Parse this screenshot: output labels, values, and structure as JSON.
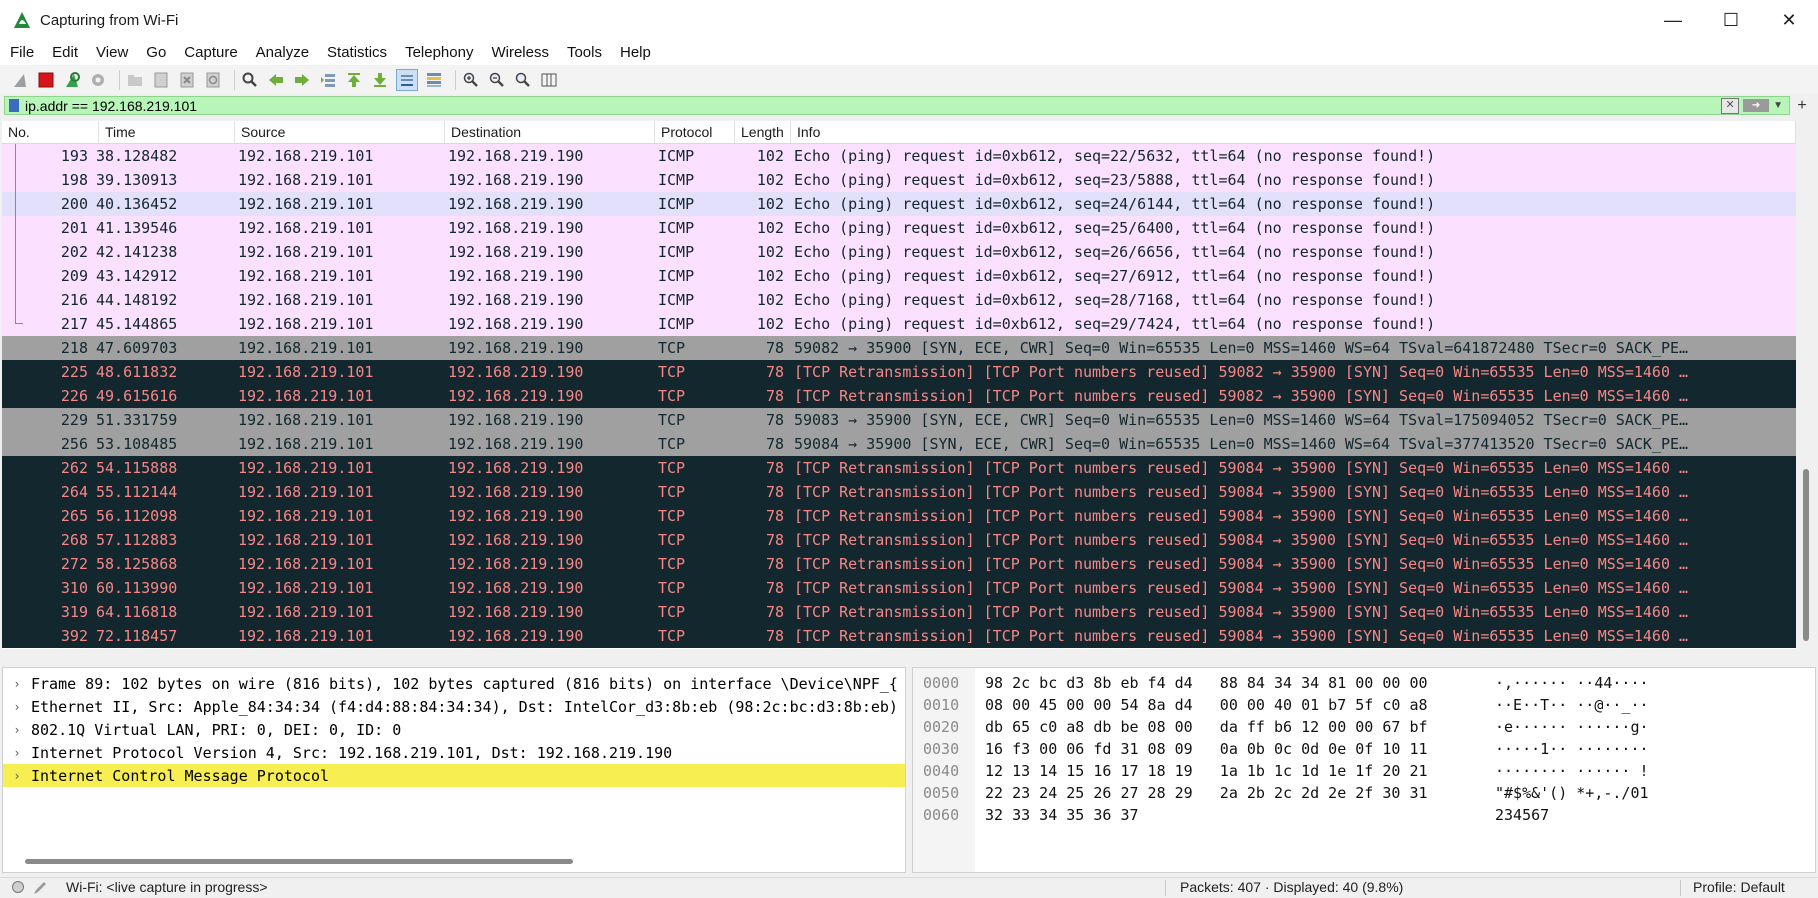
{
  "window": {
    "title": "Capturing from Wi-Fi",
    "controls": {
      "minimize": "—",
      "maximize": "☐",
      "close": "✕"
    }
  },
  "menu": [
    "File",
    "Edit",
    "View",
    "Go",
    "Capture",
    "Analyze",
    "Statistics",
    "Telephony",
    "Wireless",
    "Tools",
    "Help"
  ],
  "filter": {
    "value": "ip.addr == 192.168.219.101",
    "plus": "+"
  },
  "columns": [
    "No.",
    "Time",
    "Source",
    "Destination",
    "Protocol",
    "Length",
    "Info"
  ],
  "packets": [
    {
      "no": "193",
      "time": "38.128482",
      "src": "192.168.219.101",
      "dst": "192.168.219.190",
      "proto": "ICMP",
      "len": "102",
      "info": "Echo (ping) request  id=0xb612, seq=22/5632, ttl=64 (no response found!)",
      "style": "icmp"
    },
    {
      "no": "198",
      "time": "39.130913",
      "src": "192.168.219.101",
      "dst": "192.168.219.190",
      "proto": "ICMP",
      "len": "102",
      "info": "Echo (ping) request  id=0xb612, seq=23/5888, ttl=64 (no response found!)",
      "style": "icmp"
    },
    {
      "no": "200",
      "time": "40.136452",
      "src": "192.168.219.101",
      "dst": "192.168.219.190",
      "proto": "ICMP",
      "len": "102",
      "info": "Echo (ping) request  id=0xb612, seq=24/6144, ttl=64 (no response found!)",
      "style": "icmp sel"
    },
    {
      "no": "201",
      "time": "41.139546",
      "src": "192.168.219.101",
      "dst": "192.168.219.190",
      "proto": "ICMP",
      "len": "102",
      "info": "Echo (ping) request  id=0xb612, seq=25/6400, ttl=64 (no response found!)",
      "style": "icmp"
    },
    {
      "no": "202",
      "time": "42.141238",
      "src": "192.168.219.101",
      "dst": "192.168.219.190",
      "proto": "ICMP",
      "len": "102",
      "info": "Echo (ping) request  id=0xb612, seq=26/6656, ttl=64 (no response found!)",
      "style": "icmp"
    },
    {
      "no": "209",
      "time": "43.142912",
      "src": "192.168.219.101",
      "dst": "192.168.219.190",
      "proto": "ICMP",
      "len": "102",
      "info": "Echo (ping) request  id=0xb612, seq=27/6912, ttl=64 (no response found!)",
      "style": "icmp"
    },
    {
      "no": "216",
      "time": "44.148192",
      "src": "192.168.219.101",
      "dst": "192.168.219.190",
      "proto": "ICMP",
      "len": "102",
      "info": "Echo (ping) request  id=0xb612, seq=28/7168, ttl=64 (no response found!)",
      "style": "icmp"
    },
    {
      "no": "217",
      "time": "45.144865",
      "src": "192.168.219.101",
      "dst": "192.168.219.190",
      "proto": "ICMP",
      "len": "102",
      "info": "Echo (ping) request  id=0xb612, seq=29/7424, ttl=64 (no response found!)",
      "style": "icmp"
    },
    {
      "no": "218",
      "time": "47.609703",
      "src": "192.168.219.101",
      "dst": "192.168.219.190",
      "proto": "TCP",
      "len": "78",
      "info": "59082 → 35900 [SYN, ECE, CWR] Seq=0 Win=65535 Len=0 MSS=1460 WS=64 TSval=641872480 TSecr=0 SACK_PE…",
      "style": "tcpsyn"
    },
    {
      "no": "225",
      "time": "48.611832",
      "src": "192.168.219.101",
      "dst": "192.168.219.190",
      "proto": "TCP",
      "len": "78",
      "info": "[TCP Retransmission] [TCP Port numbers reused] 59082 → 35900 [SYN] Seq=0 Win=65535 Len=0 MSS=1460 …",
      "style": "retrans"
    },
    {
      "no": "226",
      "time": "49.615616",
      "src": "192.168.219.101",
      "dst": "192.168.219.190",
      "proto": "TCP",
      "len": "78",
      "info": "[TCP Retransmission] [TCP Port numbers reused] 59082 → 35900 [SYN] Seq=0 Win=65535 Len=0 MSS=1460 …",
      "style": "retrans"
    },
    {
      "no": "229",
      "time": "51.331759",
      "src": "192.168.219.101",
      "dst": "192.168.219.190",
      "proto": "TCP",
      "len": "78",
      "info": "59083 → 35900 [SYN, ECE, CWR] Seq=0 Win=65535 Len=0 MSS=1460 WS=64 TSval=175094052 TSecr=0 SACK_PE…",
      "style": "tcpsyn"
    },
    {
      "no": "256",
      "time": "53.108485",
      "src": "192.168.219.101",
      "dst": "192.168.219.190",
      "proto": "TCP",
      "len": "78",
      "info": "59084 → 35900 [SYN, ECE, CWR] Seq=0 Win=65535 Len=0 MSS=1460 WS=64 TSval=377413520 TSecr=0 SACK_PE…",
      "style": "tcpsyn"
    },
    {
      "no": "262",
      "time": "54.115888",
      "src": "192.168.219.101",
      "dst": "192.168.219.190",
      "proto": "TCP",
      "len": "78",
      "info": "[TCP Retransmission] [TCP Port numbers reused] 59084 → 35900 [SYN] Seq=0 Win=65535 Len=0 MSS=1460 …",
      "style": "retrans"
    },
    {
      "no": "264",
      "time": "55.112144",
      "src": "192.168.219.101",
      "dst": "192.168.219.190",
      "proto": "TCP",
      "len": "78",
      "info": "[TCP Retransmission] [TCP Port numbers reused] 59084 → 35900 [SYN] Seq=0 Win=65535 Len=0 MSS=1460 …",
      "style": "retrans"
    },
    {
      "no": "265",
      "time": "56.112098",
      "src": "192.168.219.101",
      "dst": "192.168.219.190",
      "proto": "TCP",
      "len": "78",
      "info": "[TCP Retransmission] [TCP Port numbers reused] 59084 → 35900 [SYN] Seq=0 Win=65535 Len=0 MSS=1460 …",
      "style": "retrans"
    },
    {
      "no": "268",
      "time": "57.112883",
      "src": "192.168.219.101",
      "dst": "192.168.219.190",
      "proto": "TCP",
      "len": "78",
      "info": "[TCP Retransmission] [TCP Port numbers reused] 59084 → 35900 [SYN] Seq=0 Win=65535 Len=0 MSS=1460 …",
      "style": "retrans"
    },
    {
      "no": "272",
      "time": "58.125868",
      "src": "192.168.219.101",
      "dst": "192.168.219.190",
      "proto": "TCP",
      "len": "78",
      "info": "[TCP Retransmission] [TCP Port numbers reused] 59084 → 35900 [SYN] Seq=0 Win=65535 Len=0 MSS=1460 …",
      "style": "retrans"
    },
    {
      "no": "310",
      "time": "60.113990",
      "src": "192.168.219.101",
      "dst": "192.168.219.190",
      "proto": "TCP",
      "len": "78",
      "info": "[TCP Retransmission] [TCP Port numbers reused] 59084 → 35900 [SYN] Seq=0 Win=65535 Len=0 MSS=1460 …",
      "style": "retrans"
    },
    {
      "no": "319",
      "time": "64.116818",
      "src": "192.168.219.101",
      "dst": "192.168.219.190",
      "proto": "TCP",
      "len": "78",
      "info": "[TCP Retransmission] [TCP Port numbers reused] 59084 → 35900 [SYN] Seq=0 Win=65535 Len=0 MSS=1460 …",
      "style": "retrans"
    },
    {
      "no": "392",
      "time": "72.118457",
      "src": "192.168.219.101",
      "dst": "192.168.219.190",
      "proto": "TCP",
      "len": "78",
      "info": "[TCP Retransmission] [TCP Port numbers reused] 59084 → 35900 [SYN] Seq=0 Win=65535 Len=0 MSS=1460 …",
      "style": "retrans"
    }
  ],
  "details": [
    {
      "text": "Frame 89: 102 bytes on wire (816 bits), 102 bytes captured (816 bits) on interface \\Device\\NPF_{",
      "selected": false
    },
    {
      "text": "Ethernet II, Src: Apple_84:34:34 (f4:d4:88:84:34:34), Dst: IntelCor_d3:8b:eb (98:2c:bc:d3:8b:eb)",
      "selected": false
    },
    {
      "text": "802.1Q Virtual LAN, PRI: 0, DEI: 0, ID: 0",
      "selected": false
    },
    {
      "text": "Internet Protocol Version 4, Src: 192.168.219.101, Dst: 192.168.219.190",
      "selected": false
    },
    {
      "text": "Internet Control Message Protocol",
      "selected": true
    }
  ],
  "bytes": [
    {
      "offset": "0000",
      "hex": "98 2c bc d3 8b eb f4 d4   88 84 34 34 81 00 00 00",
      "ascii": "·,······ ··44····"
    },
    {
      "offset": "0010",
      "hex": "08 00 45 00 00 54 8a d4   00 00 40 01 b7 5f c0 a8",
      "ascii": "··E··T·· ··@··_··"
    },
    {
      "offset": "0020",
      "hex": "db 65 c0 a8 db be 08 00   da ff b6 12 00 00 67 bf",
      "ascii": "·e······ ······g·"
    },
    {
      "offset": "0030",
      "hex": "16 f3 00 06 fd 31 08 09   0a 0b 0c 0d 0e 0f 10 11",
      "ascii": "·····1·· ········"
    },
    {
      "offset": "0040",
      "hex": "12 13 14 15 16 17 18 19   1a 1b 1c 1d 1e 1f 20 21",
      "ascii": "········ ······ !"
    },
    {
      "offset": "0050",
      "hex": "22 23 24 25 26 27 28 29   2a 2b 2c 2d 2e 2f 30 31",
      "ascii": "\"#$%&'() *+,-./01"
    },
    {
      "offset": "0060",
      "hex": "32 33 34 35 36 37",
      "ascii": "234567"
    }
  ],
  "status": {
    "capture": "Wi-Fi: <live capture in progress>",
    "packets": "Packets: 407 · Displayed: 40 (9.8%)",
    "profile": "Profile: Default"
  },
  "icons": [
    "shark-fin-icon",
    "stop-icon",
    "restart-icon",
    "options-icon",
    "open-icon",
    "save-icon",
    "close-file-icon",
    "reload-icon",
    "find-icon",
    "back-icon",
    "forward-icon",
    "goto-icon",
    "first-icon",
    "last-icon",
    "autoscroll-icon",
    "colorize-icon",
    "zoom-in-icon",
    "zoom-out-icon",
    "normal-size-icon",
    "resize-columns-icon"
  ],
  "colors": {
    "icmp_bg": "#fce0ff",
    "icmp_sel_bg": "#e3e0fc",
    "tcp_syn_bg": "#a0a0a0",
    "retrans_bg": "#12272e",
    "retrans_fg": "#f78787",
    "filter_ok": "#b8f5b8",
    "detail_sel": "#f7ef52"
  }
}
